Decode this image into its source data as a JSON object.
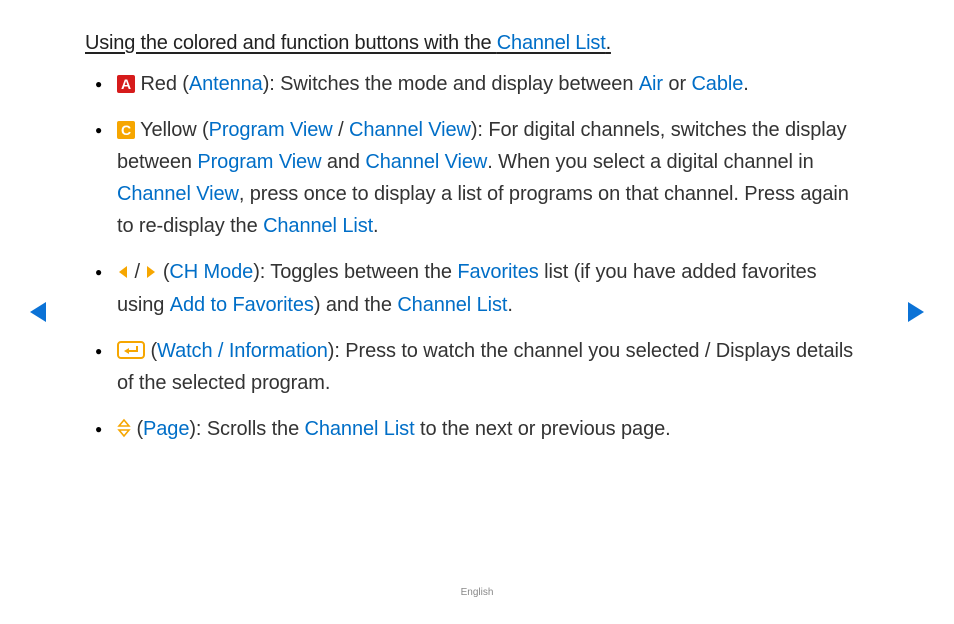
{
  "heading": {
    "t0": "Using the colored and function buttons with the ",
    "channel_list": "Channel List",
    "period": "."
  },
  "items": [
    {
      "icon_label": "A",
      "p0": " Red (",
      "antenna": "Antenna",
      "p1": "): Switches the mode and display between ",
      "air": "Air",
      "p2": " or ",
      "cable": "Cable",
      "p3": "."
    },
    {
      "icon_label": "C",
      "p0": " Yellow (",
      "program_view": "Program View",
      "sep": " / ",
      "channel_view": "Channel View",
      "p1": "): For digital channels, switches the display between ",
      "program_view2": "Program View",
      "p2": " and ",
      "channel_view2": "Channel View",
      "p3": ". When you select a digital channel in ",
      "channel_view3": "Channel View",
      "p4": ", press once to display a list of programs on that channel. Press again to re-display the ",
      "channel_list": "Channel List",
      "p5": "."
    },
    {
      "p0a": " / ",
      "p0b": " (",
      "ch_mode": "CH Mode",
      "p1": "): Toggles between the ",
      "favorites": "Favorites",
      "p2": " list (if you have added favorites using ",
      "add_fav": "Add to Favorites",
      "p3": ") and the ",
      "channel_list": "Channel List",
      "p4": "."
    },
    {
      "p0": " (",
      "watch_info": "Watch / Information",
      "p1": "): Press to watch the channel you selected / Displays details of the selected program."
    },
    {
      "p0": " (",
      "page": "Page",
      "p1": "): Scrolls the ",
      "channel_list": "Channel List",
      "p2": " to the next or previous page."
    }
  ],
  "footer": "English"
}
